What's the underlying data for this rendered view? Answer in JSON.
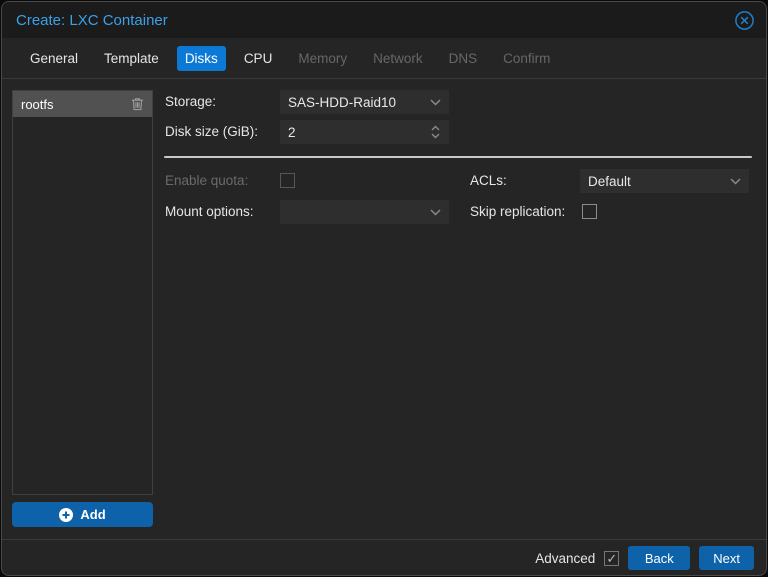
{
  "window": {
    "title": "Create: LXC Container"
  },
  "tabs": [
    {
      "label": "General",
      "state": "enabled"
    },
    {
      "label": "Template",
      "state": "enabled"
    },
    {
      "label": "Disks",
      "state": "active"
    },
    {
      "label": "CPU",
      "state": "enabled"
    },
    {
      "label": "Memory",
      "state": "disabled"
    },
    {
      "label": "Network",
      "state": "disabled"
    },
    {
      "label": "DNS",
      "state": "disabled"
    },
    {
      "label": "Confirm",
      "state": "disabled"
    }
  ],
  "disk_list": {
    "items": [
      {
        "label": "rootfs",
        "selected": true
      }
    ],
    "add_button_label": "Add"
  },
  "form": {
    "storage": {
      "label": "Storage:",
      "value": "SAS-HDD-Raid10"
    },
    "disk_size": {
      "label": "Disk size (GiB):",
      "value": "2"
    },
    "enable_quota": {
      "label": "Enable quota:",
      "checked": false,
      "disabled": true
    },
    "acls": {
      "label": "ACLs:",
      "value": "Default"
    },
    "mount_options": {
      "label": "Mount options:",
      "value": ""
    },
    "skip_replication": {
      "label": "Skip replication:",
      "checked": false
    }
  },
  "footer": {
    "advanced_label": "Advanced",
    "advanced_checked": true,
    "advanced_check_glyph": "✓",
    "back_label": "Back",
    "next_label": "Next"
  },
  "colors": {
    "title_blue": "#3ba1e8",
    "active_tab_blue": "#0c79d7",
    "button_blue": "#0d62a9",
    "dialog_bg": "#252525",
    "field_bg": "#2e2e2e",
    "selected_row_bg": "#515151"
  }
}
